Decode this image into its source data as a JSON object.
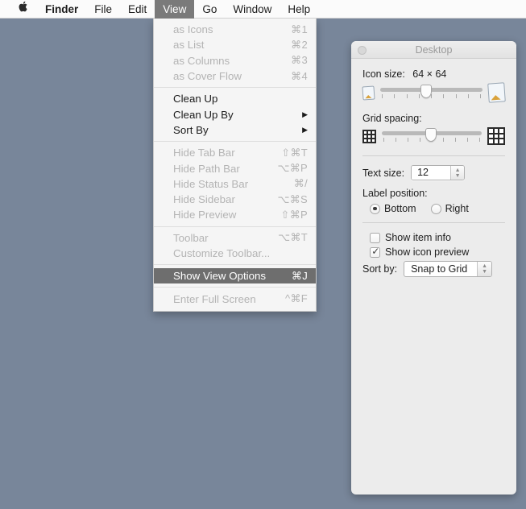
{
  "menubar": {
    "apple_icon": "apple-icon",
    "apple_glyph": "",
    "items": [
      {
        "label": "Finder",
        "bold": true,
        "active": false
      },
      {
        "label": "File",
        "bold": false,
        "active": false
      },
      {
        "label": "Edit",
        "bold": false,
        "active": false
      },
      {
        "label": "View",
        "bold": false,
        "active": true
      },
      {
        "label": "Go",
        "bold": false,
        "active": false
      },
      {
        "label": "Window",
        "bold": false,
        "active": false
      },
      {
        "label": "Help",
        "bold": false,
        "active": false
      }
    ]
  },
  "view_menu": {
    "groups": [
      [
        {
          "label": "as Icons",
          "shortcut": "⌘1",
          "disabled": true,
          "submenu": false,
          "highlight": false
        },
        {
          "label": "as List",
          "shortcut": "⌘2",
          "disabled": true,
          "submenu": false,
          "highlight": false
        },
        {
          "label": "as Columns",
          "shortcut": "⌘3",
          "disabled": true,
          "submenu": false,
          "highlight": false
        },
        {
          "label": "as Cover Flow",
          "shortcut": "⌘4",
          "disabled": true,
          "submenu": false,
          "highlight": false
        }
      ],
      [
        {
          "label": "Clean Up",
          "shortcut": "",
          "disabled": false,
          "submenu": false,
          "highlight": false
        },
        {
          "label": "Clean Up By",
          "shortcut": "",
          "disabled": false,
          "submenu": true,
          "highlight": false
        },
        {
          "label": "Sort By",
          "shortcut": "",
          "disabled": false,
          "submenu": true,
          "highlight": false
        }
      ],
      [
        {
          "label": "Hide Tab Bar",
          "shortcut": "⇧⌘T",
          "disabled": true,
          "submenu": false,
          "highlight": false
        },
        {
          "label": "Hide Path Bar",
          "shortcut": "⌥⌘P",
          "disabled": true,
          "submenu": false,
          "highlight": false
        },
        {
          "label": "Hide Status Bar",
          "shortcut": "⌘/",
          "disabled": true,
          "submenu": false,
          "highlight": false
        },
        {
          "label": "Hide Sidebar",
          "shortcut": "⌥⌘S",
          "disabled": true,
          "submenu": false,
          "highlight": false
        },
        {
          "label": "Hide Preview",
          "shortcut": "⇧⌘P",
          "disabled": true,
          "submenu": false,
          "highlight": false
        }
      ],
      [
        {
          "label": "Toolbar",
          "shortcut": "⌥⌘T",
          "disabled": true,
          "submenu": false,
          "highlight": false
        },
        {
          "label": "Customize Toolbar...",
          "shortcut": "",
          "disabled": true,
          "submenu": false,
          "highlight": false
        }
      ],
      [
        {
          "label": "Show View Options",
          "shortcut": "⌘J",
          "disabled": false,
          "submenu": false,
          "highlight": true
        }
      ],
      [
        {
          "label": "Enter Full Screen",
          "shortcut": "^⌘F",
          "disabled": true,
          "submenu": false,
          "highlight": false
        }
      ]
    ]
  },
  "panel": {
    "title": "Desktop",
    "close_button_name": "close-button",
    "icon_size": {
      "label": "Icon size:",
      "value": "64 × 64",
      "slider_percent": 45,
      "min_icon": "small-photo-icon",
      "max_icon": "large-photo-icon"
    },
    "grid_spacing": {
      "label": "Grid spacing:",
      "slider_percent": 49,
      "min_icon": "small-grid-icon",
      "max_icon": "large-grid-icon"
    },
    "text_size": {
      "label": "Text size:",
      "value": "12",
      "stepper_up": "▲",
      "stepper_down": "▼"
    },
    "label_position": {
      "label": "Label position:",
      "options": [
        {
          "label": "Bottom",
          "selected": true
        },
        {
          "label": "Right",
          "selected": false
        }
      ]
    },
    "checkboxes": [
      {
        "label": "Show item info",
        "checked": false
      },
      {
        "label": "Show icon preview",
        "checked": true
      }
    ],
    "sort_by": {
      "label": "Sort by:",
      "value": "Snap to Grid",
      "arrow_up": "▲",
      "arrow_down": "▼"
    }
  },
  "colors": {
    "desktop": "#78869a",
    "menubar_bg": "#fbfbfb",
    "menu_highlight": "#6e6e6e",
    "menu_disabled_text": "#b4b4b4",
    "panel_bg": "#ececec",
    "panel_title_text": "#9a9a9a"
  }
}
